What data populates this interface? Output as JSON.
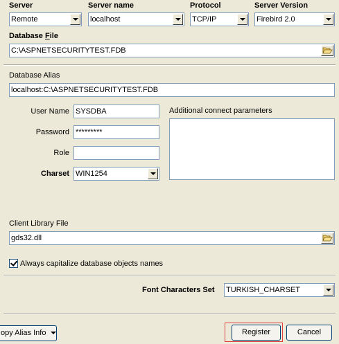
{
  "server": {
    "label": "Server",
    "value": "Remote"
  },
  "server_name": {
    "label": "Server name",
    "value": "localhost"
  },
  "protocol": {
    "label": "Protocol",
    "value": "TCP/IP"
  },
  "server_version": {
    "label": "Server Version",
    "value": "Firebird 2.0"
  },
  "database_file": {
    "label_prefix": "Database ",
    "label_hot": "F",
    "label_suffix": "ile",
    "value": "C:\\ASPNETSECURITYTEST.FDB"
  },
  "database_alias": {
    "label": "Database Alias",
    "value": "localhost:C:\\ASPNETSECURITYTEST.FDB"
  },
  "credentials": {
    "user_name_label": "User Name",
    "user_name": "SYSDBA",
    "password_label": "Password",
    "password": "*********",
    "role_label": "Role",
    "role": "",
    "charset_label": "Charset",
    "charset": "WIN1254"
  },
  "additional_params": {
    "label": "Additional connect parameters",
    "value": ""
  },
  "client_library": {
    "label": "Client Library File",
    "value": "gds32.dll"
  },
  "capitalize": {
    "label": "Always capitalize database objects names",
    "checked": true
  },
  "font_charset": {
    "label": "Font Characters Set",
    "value": "TURKISH_CHARSET"
  },
  "buttons": {
    "copy_alias": "opy Alias Info",
    "register": "Register",
    "cancel": "Cancel"
  },
  "icons": {
    "dropdown": "chevron-down-icon",
    "browse": "folder-open-icon",
    "check": "checkmark-icon"
  },
  "colors": {
    "window": "#ece9d8",
    "field_border": "#7f9db9",
    "focus_highlight": "#e04040"
  }
}
